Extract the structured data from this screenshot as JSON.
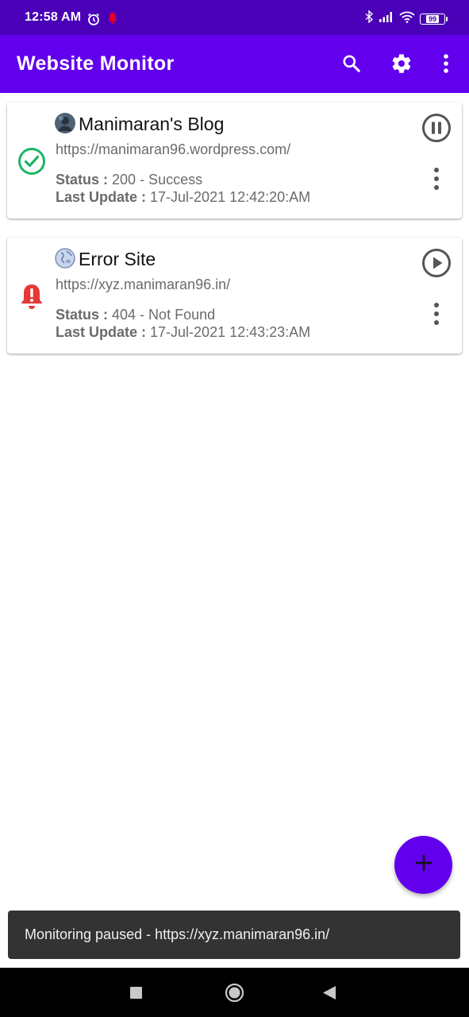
{
  "status_bar": {
    "time": "12:58 AM",
    "battery": "99",
    "icons": [
      "alarm-icon",
      "notification-bell-icon",
      "bluetooth-icon",
      "signal-icon",
      "wifi-icon",
      "battery-icon"
    ]
  },
  "app_bar": {
    "title": "Website Monitor",
    "actions": [
      "search-icon",
      "settings-gear-icon",
      "overflow-menu-icon"
    ],
    "color": "#6200ee"
  },
  "sites": [
    {
      "name": "Manimaran's Blog",
      "url": "https://manimaran96.wordpress.com/",
      "status_label": "Status :",
      "status_value": "200 - Success",
      "update_label": "Last Update :",
      "update_value": "17-Jul-2021 12:42:20:AM",
      "state_icon": "check-circle-icon",
      "state_color": "#1db567",
      "toggle_icon": "pause-circle-icon"
    },
    {
      "name": "Error Site",
      "url": "https://xyz.manimaran96.in/",
      "status_label": "Status :",
      "status_value": "404 - Not Found",
      "update_label": "Last Update :",
      "update_value": "17-Jul-2021 12:43:23:AM",
      "state_icon": "alert-bell-icon",
      "state_color": "#e53935",
      "toggle_icon": "play-circle-icon"
    }
  ],
  "fab": {
    "icon": "plus-icon"
  },
  "snackbar": {
    "message": "Monitoring paused - https://xyz.manimaran96.in/"
  },
  "nav_bar": {
    "buttons": [
      "recents-square-icon",
      "home-circle-icon",
      "back-triangle-icon"
    ]
  }
}
